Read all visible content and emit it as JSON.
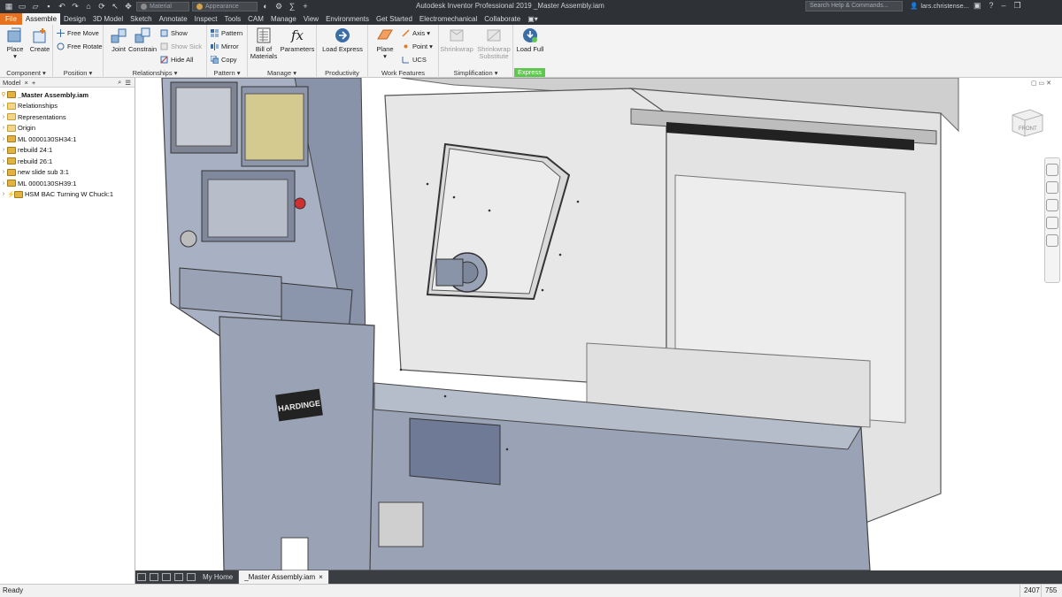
{
  "app": {
    "title": "Autodesk Inventor Professional 2019   _Master Assembly.iam",
    "material_placeholder": "Material",
    "appearance_placeholder": "Appearance",
    "search_placeholder": "Search Help & Commands...",
    "user": "lars.christense...",
    "minimize": "–",
    "maximize": "❐",
    "help": "?"
  },
  "menu": {
    "tabs": [
      {
        "label": "File"
      },
      {
        "label": "Assemble"
      },
      {
        "label": "Design"
      },
      {
        "label": "3D Model"
      },
      {
        "label": "Sketch"
      },
      {
        "label": "Annotate"
      },
      {
        "label": "Inspect"
      },
      {
        "label": "Tools"
      },
      {
        "label": "CAM"
      },
      {
        "label": "Manage"
      },
      {
        "label": "View"
      },
      {
        "label": "Environments"
      },
      {
        "label": "Get Started"
      },
      {
        "label": "Electromechanical"
      },
      {
        "label": "Collaborate"
      }
    ]
  },
  "ribbon": {
    "component": {
      "label": "Component ▾",
      "place": "Place",
      "place_arrow": "▾",
      "create": "Create"
    },
    "position": {
      "label": "Position ▾",
      "free_move": "Free Move",
      "free_rotate": "Free Rotate"
    },
    "relationships": {
      "label": "Relationships ▾",
      "joint": "Joint",
      "constrain": "Constrain",
      "show": "Show",
      "show_sick": "Show Sick",
      "hide_all": "Hide All"
    },
    "pattern": {
      "label": "Pattern ▾",
      "pattern": "Pattern",
      "mirror": "Mirror",
      "copy": "Copy"
    },
    "manage": {
      "label": "Manage ▾",
      "bom_line1": "Bill of",
      "bom_line2": "Materials",
      "parameters": "Parameters"
    },
    "productivity": {
      "label": "Productivity",
      "load_express": "Load Express"
    },
    "work_features": {
      "label": "Work Features",
      "plane": "Plane",
      "plane_arrow": "▾",
      "axis": "Axis ▾",
      "point": "Point ▾",
      "ucs": "UCS"
    },
    "simplification": {
      "label": "Simplification ▾",
      "shrinkwrap": "Shrinkwrap",
      "shrinkwrap_sub_line1": "Shrinkwrap",
      "shrinkwrap_sub_line2": "Substitute"
    },
    "express": {
      "label": "Express",
      "load_full": "Load Full"
    }
  },
  "browser": {
    "title": "Model",
    "close": "×",
    "add": "+",
    "search_icon": "search",
    "menu_icon": "menu",
    "items": [
      {
        "label": "_Master Assembly.iam",
        "icon": "assembly"
      },
      {
        "label": "Relationships",
        "icon": "folder"
      },
      {
        "label": "Representations",
        "icon": "folder"
      },
      {
        "label": "Origin",
        "icon": "folder"
      },
      {
        "label": "ML 0000130SH34:1",
        "icon": "assembly-part"
      },
      {
        "label": "rebuild 24:1",
        "icon": "assembly"
      },
      {
        "label": "rebuild 26:1",
        "icon": "assembly"
      },
      {
        "label": "new slide sub 3:1",
        "icon": "assembly"
      },
      {
        "label": "ML 0000130SH39:1",
        "icon": "assembly-part"
      },
      {
        "label": "HSM BAC Turning W Chuck:1",
        "icon": "assembly-cam"
      }
    ]
  },
  "viewport": {
    "viewcube_label": "FRONT",
    "model_nameplate": "HARDINGE"
  },
  "doctabs": {
    "my_home": "My Home",
    "active": "_Master Assembly.iam",
    "close": "×"
  },
  "status": {
    "text": "Ready",
    "count1": "2407",
    "count2": "755"
  },
  "colors": {
    "titlebar": "#2e3135",
    "file_tab": "#e8711f",
    "express_badge": "#5ec74d",
    "model_body": "#9aa3b6",
    "model_cover": "#e4e4e4"
  }
}
